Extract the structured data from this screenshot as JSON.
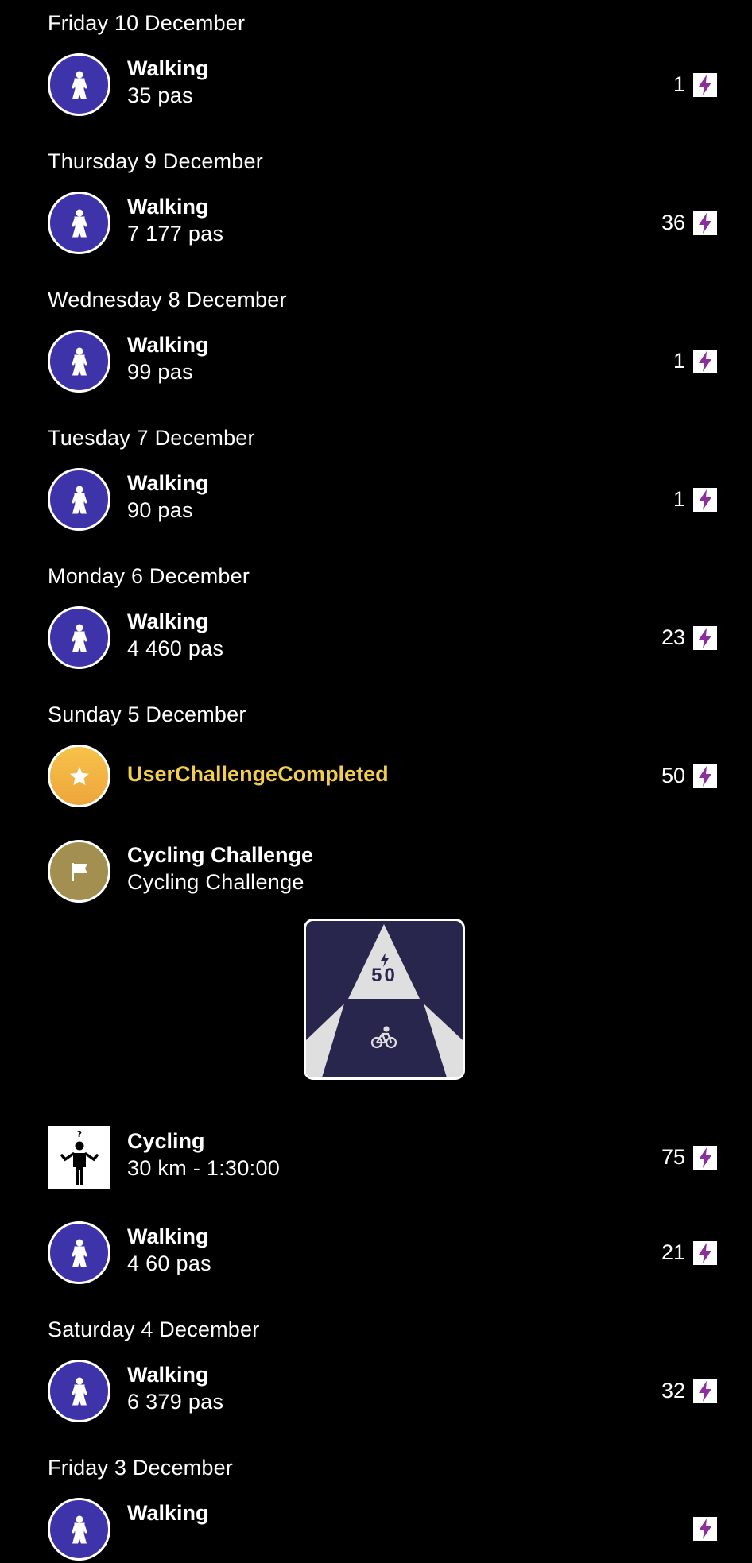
{
  "colors": {
    "background": "#000000",
    "walking_circle": "#3e33a8",
    "challenge_gold": "#f3cd4c",
    "flag_circle": "#a38f4f",
    "bolt": "#8b2f9c",
    "badge_bg": "#29264d"
  },
  "days": [
    {
      "label": "Friday 10 December"
    },
    {
      "label": "Thursday 9 December"
    },
    {
      "label": "Wednesday 8 December"
    },
    {
      "label": "Tuesday 7 December"
    },
    {
      "label": "Monday 6 December"
    },
    {
      "label": "Sunday 5 December"
    },
    {
      "label": "Saturday 4 December"
    },
    {
      "label": "Friday 3 December"
    }
  ],
  "activities": [
    {
      "icon": "walking-person-icon",
      "title": "Walking",
      "detail": "35 pas",
      "points": "1"
    },
    {
      "icon": "walking-person-icon",
      "title": "Walking",
      "detail": "7 177 pas",
      "points": "36"
    },
    {
      "icon": "walking-person-icon",
      "title": "Walking",
      "detail": "99 pas",
      "points": "1"
    },
    {
      "icon": "walking-person-icon",
      "title": "Walking",
      "detail": "90 pas",
      "points": "1"
    },
    {
      "icon": "walking-person-icon",
      "title": "Walking",
      "detail": "4 460 pas",
      "points": "23"
    },
    {
      "icon": "star-icon",
      "title": "UserChallengeCompleted",
      "points": "50"
    },
    {
      "icon": "flag-icon",
      "title": "Cycling Challenge",
      "detail": "Cycling Challenge"
    },
    {
      "icon": "unknown-person-icon",
      "title": "Cycling",
      "detail": "30 km - 1:30:00",
      "points": "75"
    },
    {
      "icon": "walking-person-icon",
      "title": "Walking",
      "detail": "4 60 pas",
      "points": "21"
    },
    {
      "icon": "walking-person-icon",
      "title": "Walking",
      "detail": "6 379 pas",
      "points": "32"
    },
    {
      "icon": "walking-person-icon",
      "title": "Walking"
    }
  ],
  "badge": {
    "value": "50",
    "icon": "bicycle-icon"
  }
}
